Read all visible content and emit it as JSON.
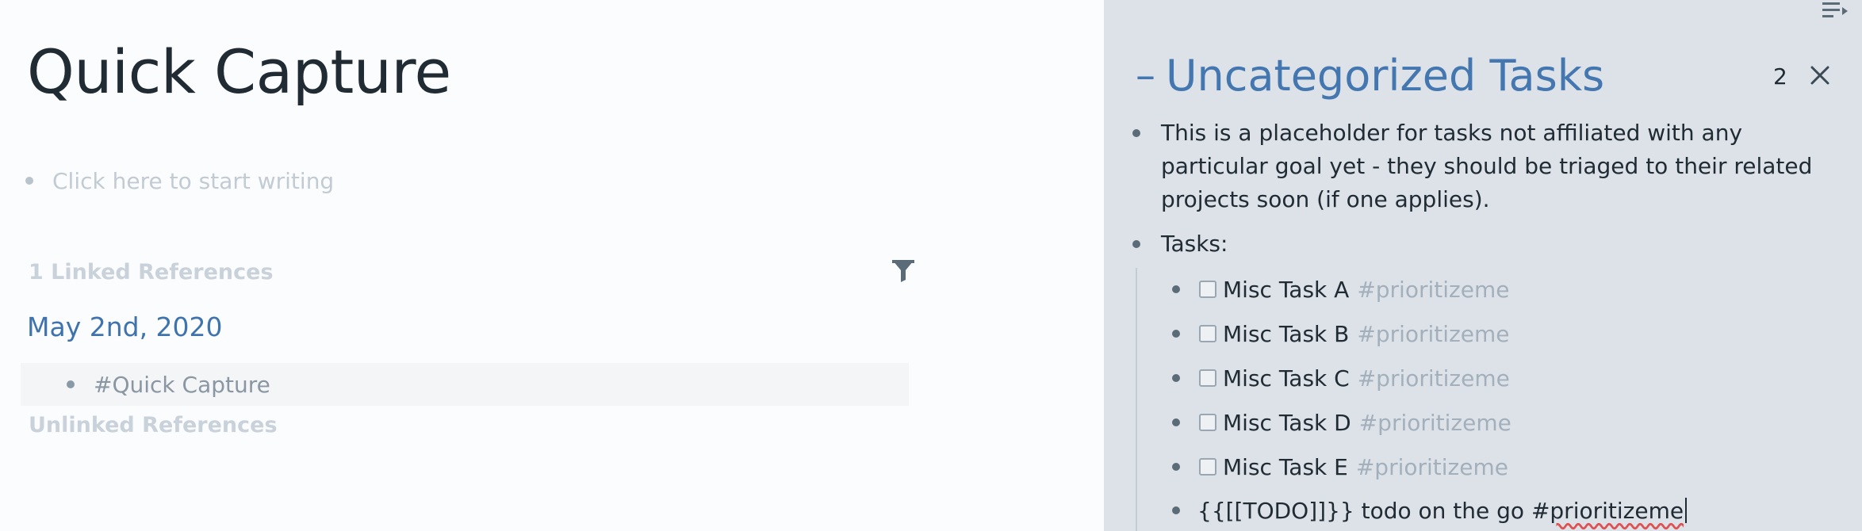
{
  "main": {
    "page_title": "Quick Capture",
    "placeholder": "Click here to start writing",
    "linked_refs_header": "1 Linked References",
    "linked_refs": [
      {
        "date": "May 2nd, 2020",
        "block_text": "#Quick Capture"
      }
    ],
    "unlinked_refs_header": "Unlinked References"
  },
  "sidebar": {
    "title": "Uncategorized Tasks",
    "collapse_symbol": "–",
    "count": "2",
    "description": "This is a placeholder for tasks not affiliated with any particular goal yet - they should be triaged to their related projects soon (if one applies).",
    "tasks_label": "Tasks:",
    "tasks": [
      {
        "label": "Misc Task A",
        "tag": "#prioritizeme"
      },
      {
        "label": "Misc Task B",
        "tag": "#prioritizeme"
      },
      {
        "label": "Misc Task C",
        "tag": "#prioritizeme"
      },
      {
        "label": "Misc Task D",
        "tag": "#prioritizeme"
      },
      {
        "label": "Misc Task E",
        "tag": "#prioritizeme"
      }
    ],
    "editing_block": {
      "prefix": "{{[[TODO]]}} todo on the go #",
      "misspelled": "prioritizeme"
    }
  },
  "icons": {
    "filter": "filter-icon",
    "close": "close-icon",
    "sidebar_menu": "sidebar-menu-icon"
  },
  "colors": {
    "link_blue": "#4477b0",
    "sidebar_bg": "#dce2e8",
    "main_bg": "#fbfcfd"
  }
}
